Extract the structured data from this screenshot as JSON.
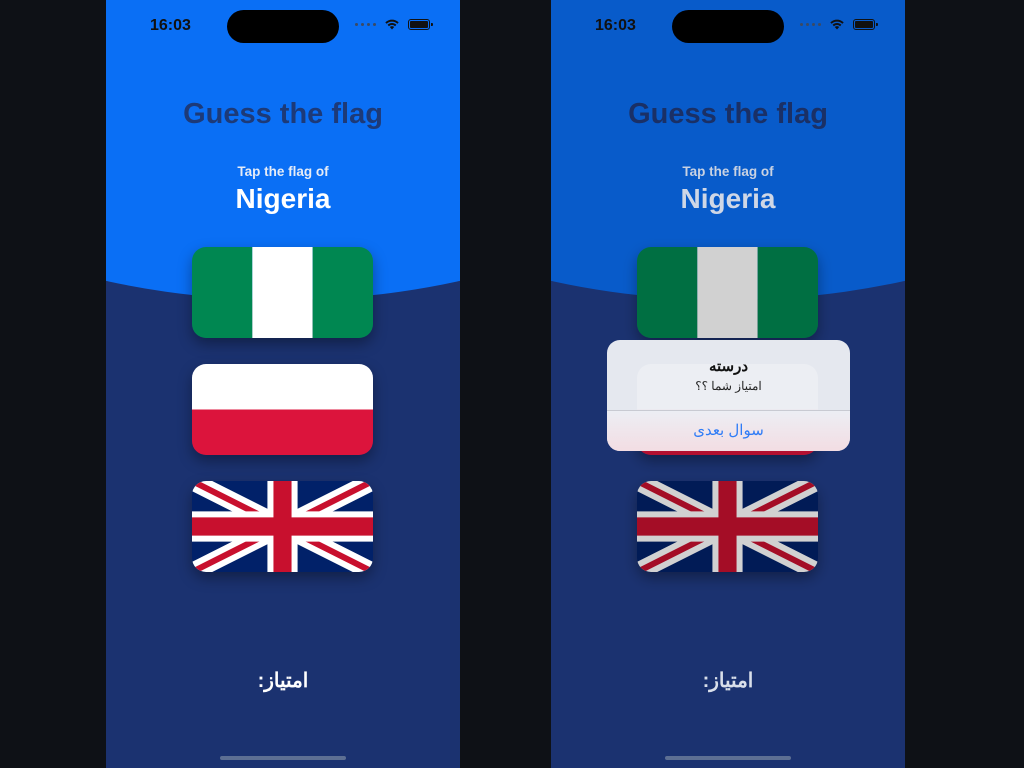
{
  "screens": [
    {
      "status_time": "16:03",
      "title": "Guess the flag",
      "prompt": "Tap the flag of",
      "country": "Nigeria",
      "flags": [
        "nigeria-flag",
        "poland-flag",
        "united-kingdom-flag"
      ],
      "score_label": "امتیاز:"
    },
    {
      "status_time": "16:03",
      "title": "Guess the flag",
      "prompt": "Tap the flag of",
      "country": "Nigeria",
      "flags": [
        "nigeria-flag",
        "poland-flag",
        "united-kingdom-flag"
      ],
      "score_label": "امتیاز:",
      "alert": {
        "title": "درسته",
        "message": "امتیاز شما ؟؟",
        "button_label": "سوال بعدی"
      }
    }
  ],
  "colors": {
    "accent_blue": "#0a6ff5",
    "background_navy": "#1b3270",
    "title_color": "#1d3a78",
    "alert_button": "#2f7cf6"
  }
}
